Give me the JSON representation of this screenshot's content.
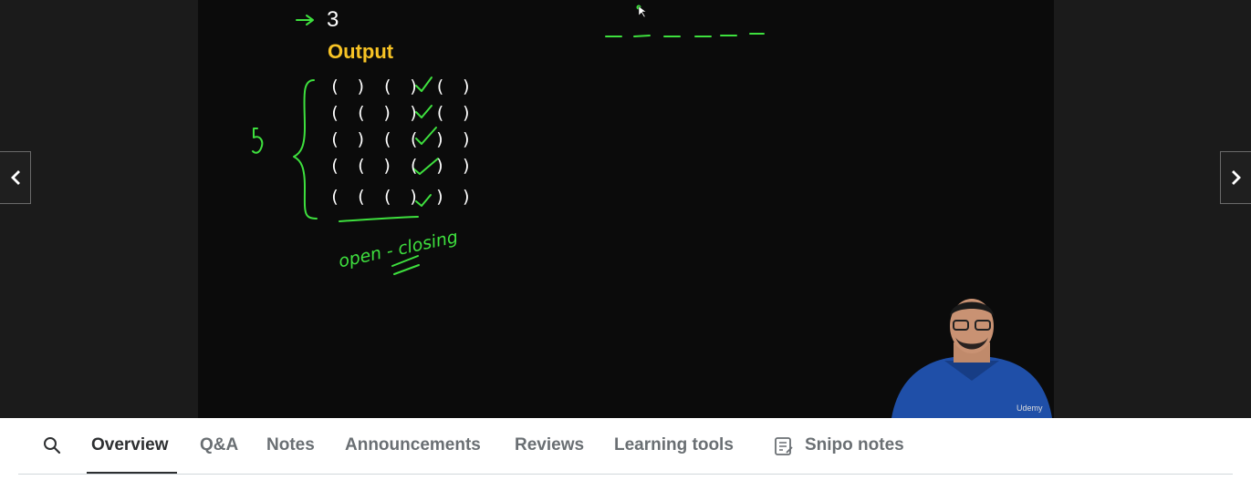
{
  "video": {
    "whiteboard": {
      "number": "3",
      "output_heading": "Output",
      "paren_lines": [
        "( ) ( ) ( )",
        "( ( ) ) ( )",
        "( ) ( ( ) )",
        "( ( ) ( ) )",
        "( ( ( ) ) )"
      ],
      "handwritten": {
        "count": "5",
        "note": "open - closing"
      }
    },
    "watermark": "Udemy",
    "colors": {
      "ink": "#3ee03e",
      "heading": "#f7c325",
      "frame": "#0b0b0b"
    }
  },
  "controls": {
    "prev_icon": "chevron-left-icon",
    "next_icon": "chevron-right-icon"
  },
  "tabs": {
    "search_icon": "search-icon",
    "items": [
      {
        "label": "Overview",
        "active": true
      },
      {
        "label": "Q&A",
        "active": false
      },
      {
        "label": "Notes",
        "active": false
      },
      {
        "label": "Announcements",
        "active": false
      },
      {
        "label": "Reviews",
        "active": false
      },
      {
        "label": "Learning tools",
        "active": false
      },
      {
        "label": "Snipo notes",
        "active": false,
        "icon": "notes-icon"
      }
    ]
  }
}
